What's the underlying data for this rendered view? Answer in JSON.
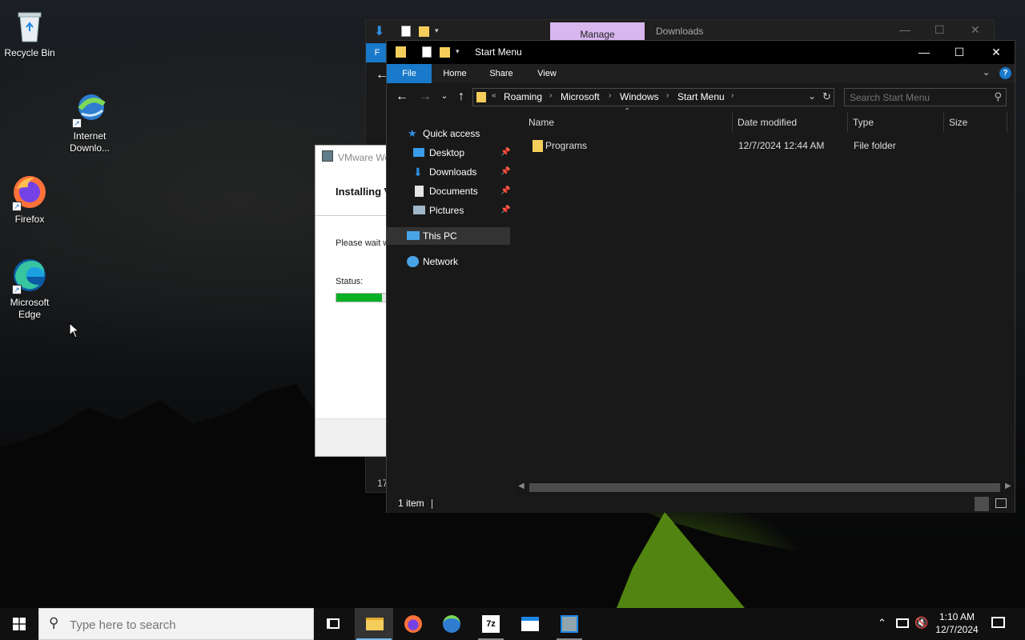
{
  "desktop": {
    "icons": [
      {
        "label": "Recycle Bin"
      },
      {
        "label": "Internet Downlo..."
      },
      {
        "label": "Firefox"
      },
      {
        "label": "Microsoft Edge"
      }
    ]
  },
  "back_window": {
    "manage_tab": "Manage",
    "title": "Downloads",
    "ribbon_tab_letter": "F",
    "status_partial": "17"
  },
  "installer": {
    "title": "VMware Wo",
    "heading": "Installing V",
    "wait_text": "Please wait w",
    "status_label": "Status:",
    "progress": 0.65
  },
  "explorer": {
    "title": "Start Menu",
    "ribbon_tabs": [
      "File",
      "Home",
      "Share",
      "View"
    ],
    "address": {
      "overflow": "«",
      "crumbs": [
        "Roaming",
        "Microsoft",
        "Windows",
        "Start Menu"
      ]
    },
    "search_placeholder": "Search Start Menu",
    "nav": {
      "quick_access": "Quick access",
      "items": [
        "Desktop",
        "Downloads",
        "Documents",
        "Pictures"
      ],
      "this_pc": "This PC",
      "network": "Network"
    },
    "columns": [
      "Name",
      "Date modified",
      "Type",
      "Size"
    ],
    "rows": [
      {
        "name": "Programs",
        "date": "12/7/2024 12:44 AM",
        "type": "File folder",
        "size": ""
      }
    ],
    "status": "1 item"
  },
  "taskbar": {
    "search_placeholder": "Type here to search",
    "time": "1:10 AM",
    "date": "12/7/2024"
  },
  "colors": {
    "accent": "#1979ca",
    "manage": "#d7b7ee",
    "progress": "#06b025"
  }
}
